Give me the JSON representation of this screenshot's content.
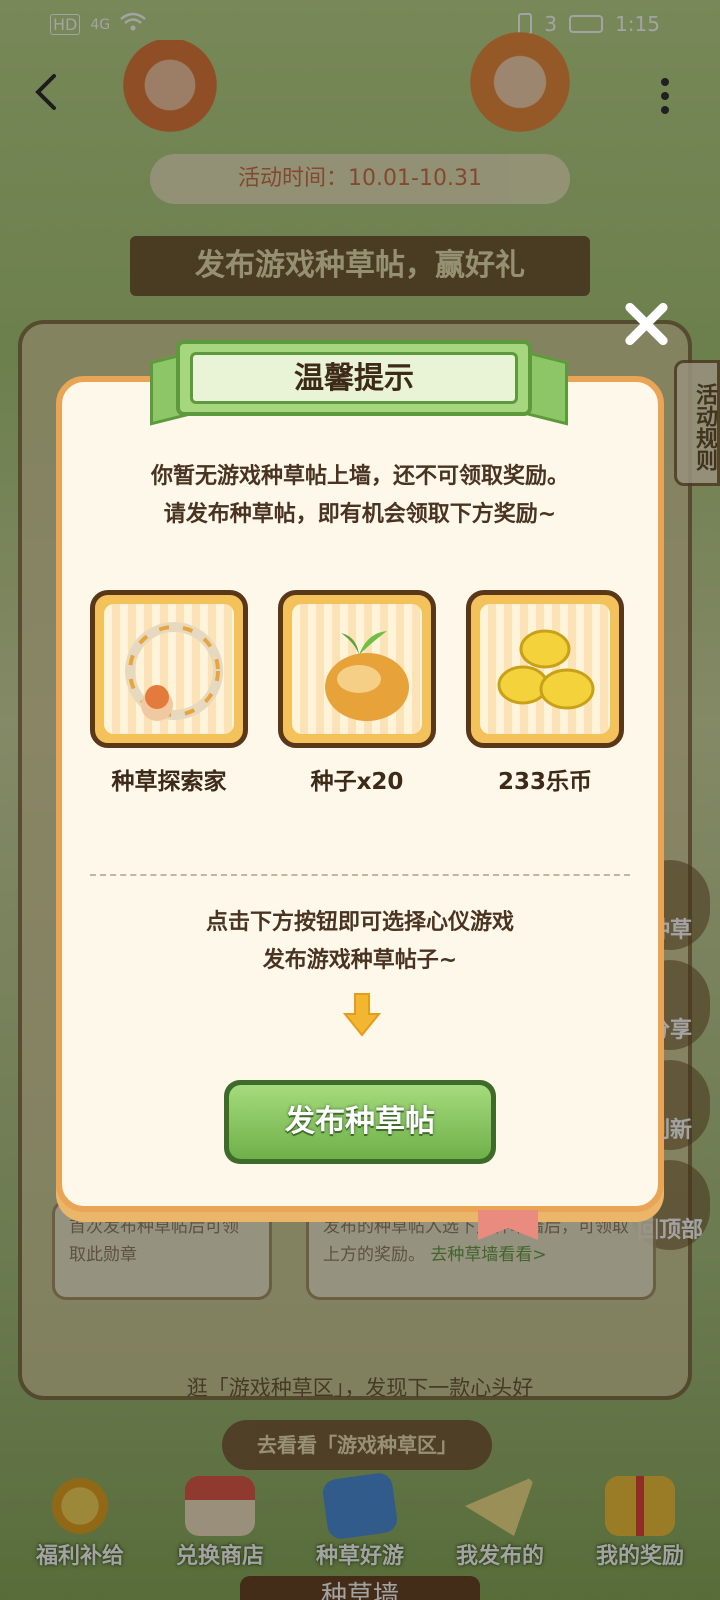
{
  "status_bar": {
    "left_icons": [
      "HD",
      "4G",
      "wifi-icon"
    ],
    "right_icons": [
      "vibrate-icon",
      "battery-icon"
    ],
    "battery_text": "3",
    "time": "1:15"
  },
  "header": {
    "event_time": "活动时间：10.01-10.31",
    "board_title": "发布游戏种草帖，赢好礼"
  },
  "side_tabs": {
    "rules_label": "活动规则",
    "float_buttons": [
      "种草",
      "分享",
      "刷新",
      "回顶部"
    ]
  },
  "background_cards": [
    {
      "text": "首次发布种草帖后可领取此勋章"
    },
    {
      "text": "发布的种草帖入选下方种草墙后，可领取上方的奖励。",
      "link": "去种草墙看看>"
    }
  ],
  "discover": {
    "text": "逛「游戏种草区」，发现下一款心头好",
    "button": "去看看「游戏种草区」"
  },
  "bottom_nav": {
    "items": [
      {
        "label": "福利补给",
        "icon": "coins-icon"
      },
      {
        "label": "兑换商店",
        "icon": "shop-icon"
      },
      {
        "label": "种草好游",
        "icon": "game-icon"
      },
      {
        "label": "我发布的",
        "icon": "paper-plane-icon"
      },
      {
        "label": "我的奖励",
        "icon": "gift-icon"
      }
    ],
    "footer_title": "种草墙"
  },
  "modal": {
    "title": "温馨提示",
    "line1": "你暂无游戏种草帖上墙，还不可领取奖励。",
    "line2": "请发布种草帖，即有机会领取下方奖励~",
    "rewards": [
      {
        "label": "种草探索家",
        "icon": "avatar-frame-icon"
      },
      {
        "label": "种子x20",
        "icon": "seed-icon"
      },
      {
        "label": "233乐币",
        "icon": "coins-icon"
      }
    ],
    "hint1": "点击下方按钮即可选择心仪游戏",
    "hint2": "发布游戏种草帖子~",
    "button": "发布种草帖",
    "colors": {
      "accent_green": "#6fb04a",
      "border_orange": "#e9a555",
      "card_bg": "#fdf8ea"
    }
  }
}
